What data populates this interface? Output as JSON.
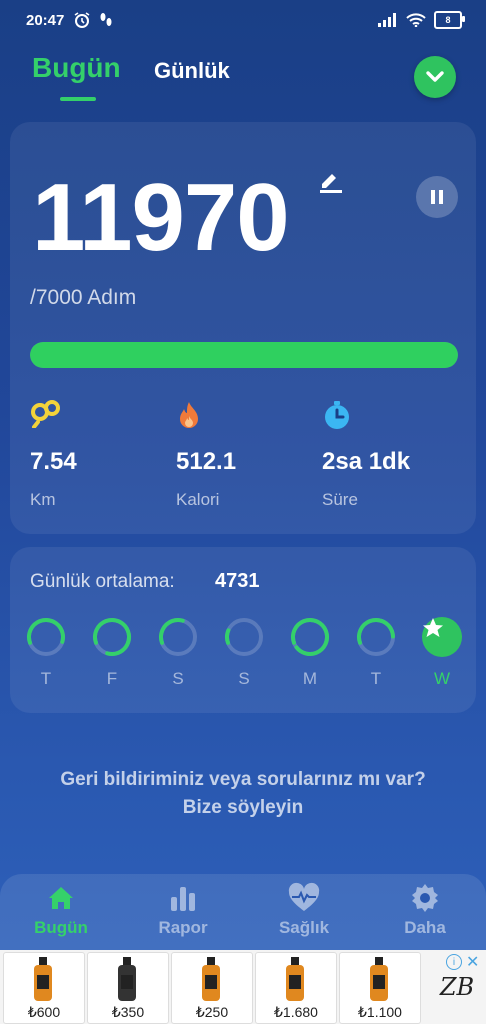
{
  "status_bar": {
    "time": "20:47",
    "battery": "8"
  },
  "header": {
    "tab_today": "Bugün",
    "tab_daily": "Günlük"
  },
  "steps": {
    "value": "11970",
    "goal": "/7000 Adım",
    "progress_fraction": 1.0
  },
  "stats": [
    {
      "value": "7.54",
      "label": "Km",
      "icon": "map-pin-icon",
      "color": "#f3d33a"
    },
    {
      "value": "512.1",
      "label": "Kalori",
      "icon": "flame-icon",
      "color": "#f07a3a"
    },
    {
      "value": "2sa 1dk",
      "label": "Süre",
      "icon": "stopwatch-icon",
      "color": "#3bb6f2"
    }
  ],
  "weekly": {
    "avg_label": "Günlük ortalama:",
    "avg_value": "4731",
    "days": [
      {
        "letter": "T",
        "progress": 0.6
      },
      {
        "letter": "F",
        "progress": 0.85
      },
      {
        "letter": "S",
        "progress": 0.35
      },
      {
        "letter": "S",
        "progress": 0.12
      },
      {
        "letter": "M",
        "progress": 0.95
      },
      {
        "letter": "T",
        "progress": 0.55
      },
      {
        "letter": "W",
        "progress": 1.0,
        "active": true
      }
    ]
  },
  "feedback": {
    "line1": "Geri bildiriminiz veya sorularınız mı var?",
    "line2": "Bize söyleyin"
  },
  "nav": [
    {
      "label": "Bugün",
      "icon": "home-icon",
      "active": true
    },
    {
      "label": "Rapor",
      "icon": "bar-chart-icon"
    },
    {
      "label": "Sağlık",
      "icon": "heart-pulse-icon"
    },
    {
      "label": "Daha",
      "icon": "gear-icon"
    }
  ],
  "ads": {
    "prices": [
      "₺600",
      "₺350",
      "₺250",
      "₺1.680",
      "₺1.100"
    ],
    "logo_text": "ZB"
  },
  "colors": {
    "accent": "#34d06a",
    "background": "#21479a"
  }
}
